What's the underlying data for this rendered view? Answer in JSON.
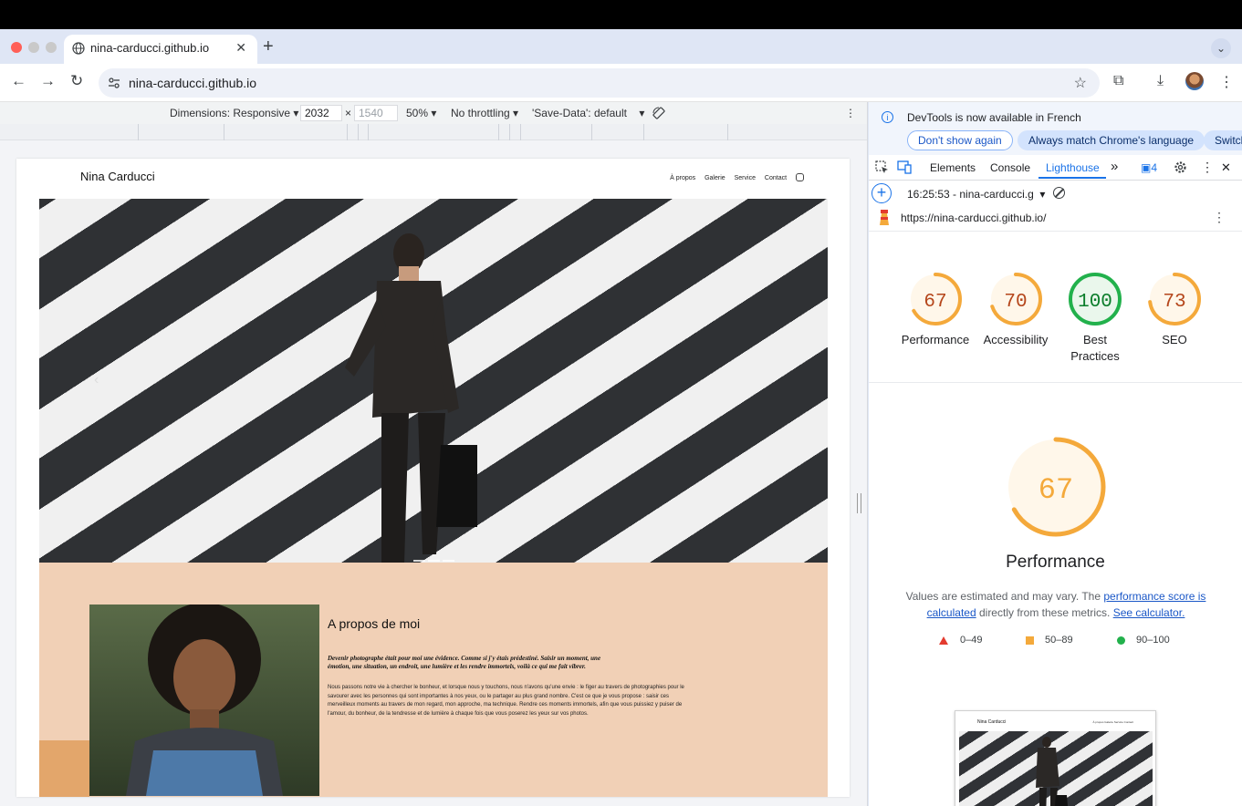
{
  "browser": {
    "tab_title": "nina-carducci.github.io",
    "tab_close": "✕",
    "new_tab": "+",
    "tab_menu": "⌄",
    "url": "nina-carducci.github.io",
    "icons": {
      "back": "←",
      "forward": "→",
      "reload": "↻",
      "star": "☆",
      "extensions": "⧉",
      "download": "⤓",
      "menu": "⋮"
    }
  },
  "device_toolbar": {
    "dimensions_label": "Dimensions: Responsive",
    "width_value": "2032",
    "times": "×",
    "height_value": "1540",
    "zoom": "50%",
    "throttling": "No throttling",
    "save_data": "'Save-Data': default",
    "caret": "▾",
    "more": "⋮"
  },
  "site": {
    "name": "Nina Carducci",
    "nav": [
      "À propos",
      "Galerie",
      "Service",
      "Contact"
    ],
    "prev_arrow": "‹",
    "about_title": "A propos de moi",
    "about_lead": "Devenir photographe était pour moi une évidence. Comme si j'y étais prédestiné. Saisir un moment, une émotion, une situation, un endroit, une lumière et les rendre immortels, voilà ce qui me fait vibrer.",
    "about_body": "Nous passons notre vie à chercher le bonheur, et lorsque nous y touchons, nous n'avons qu'une envie : le figer au travers de photographies pour le savourer avec les personnes qui sont importantes à nos yeux, ou le partager au plus grand nombre. C'est ce que je vous propose : saisir ces merveilleux moments au travers de mon regard, mon approche, ma technique. Rendre ces moments immortels, afin que vous puissiez y puiser de l'amour, du bonheur, de la tendresse et de lumière à chaque fois que vous poserez les yeux sur vos photos."
  },
  "devtools": {
    "info_message": "DevTools is now available in French",
    "info_icon": "i",
    "btn_dont_show": "Don't show again",
    "btn_always_match": "Always match Chrome's language",
    "btn_switch": "Switch",
    "tabs": [
      "Elements",
      "Console",
      "Lighthouse"
    ],
    "more_tabs": "»",
    "issues_count": "4",
    "close": "✕",
    "report_label": "16:25:53 - nina-carducci.g",
    "report_caret": "▾",
    "new_report": "+",
    "audited_url": "https://nina-carducci.github.io/",
    "kebab": "⋮",
    "scores": [
      {
        "value": 67,
        "label": "Performance",
        "color": "#f4a93b"
      },
      {
        "value": 70,
        "label": "Accessibility",
        "color": "#f4a93b"
      },
      {
        "value": 100,
        "label": "Best Practices",
        "color": "#22b14c"
      },
      {
        "value": 73,
        "label": "SEO",
        "color": "#f4a93b"
      }
    ],
    "main_score": {
      "value": 67,
      "color": "#f4a93b"
    },
    "main_title": "Performance",
    "desc_prefix": "Values are estimated and may vary. The ",
    "desc_link1": "performance score is calculated",
    "desc_middle": " directly from these metrics. ",
    "desc_link2": "See calculator.",
    "legend": [
      "0–49",
      "50–89",
      "90–100"
    ],
    "thumb_name": "Nina Carducci",
    "thumb_nav": "À propos   Galerie   Service   Contact"
  }
}
